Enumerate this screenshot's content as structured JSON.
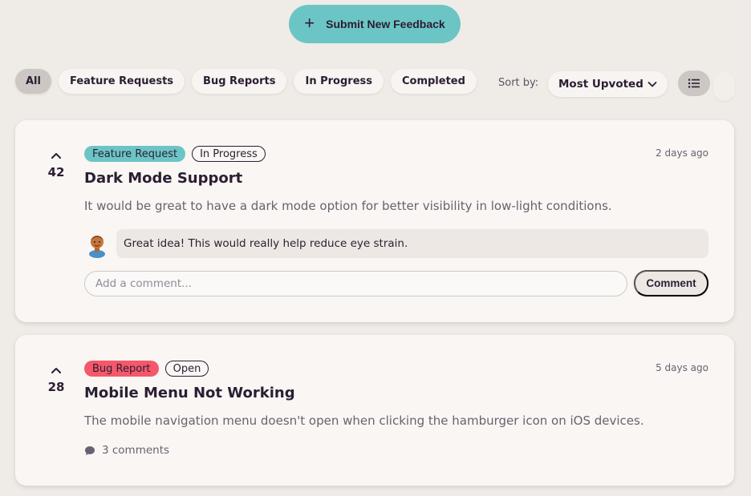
{
  "header": {
    "submit_label": "Submit New Feedback",
    "submit_icon": "plus-icon"
  },
  "filters": [
    {
      "label": "All",
      "active": true
    },
    {
      "label": "Feature Requests",
      "active": false
    },
    {
      "label": "Bug Reports",
      "active": false
    },
    {
      "label": "In Progress",
      "active": false
    },
    {
      "label": "Completed",
      "active": false
    }
  ],
  "sort": {
    "label": "Sort by:",
    "selected": "Most Upvoted"
  },
  "view_toggle": {
    "active": "list"
  },
  "colors": {
    "accent_teal": "#6cc5c5",
    "bug_red": "#f4586a",
    "background": "#efebe7",
    "card": "#f9f6f3"
  },
  "feedback": [
    {
      "votes": "42",
      "category": "Feature Request",
      "status": "In Progress",
      "time": "2 days ago",
      "title": "Dark Mode Support",
      "description": "It would be great to have a dark mode option for better visibility in low-light conditions.",
      "comment": "Great idea! This would really help reduce eye strain.",
      "comment_placeholder": "Add a comment...",
      "comment_button": "Comment"
    },
    {
      "votes": "28",
      "category": "Bug Report",
      "status": "Open",
      "time": "5 days ago",
      "title": "Mobile Menu Not Working",
      "description": "The mobile navigation menu doesn't open when clicking the hamburger icon on iOS devices.",
      "comments_count": "3 comments"
    }
  ]
}
